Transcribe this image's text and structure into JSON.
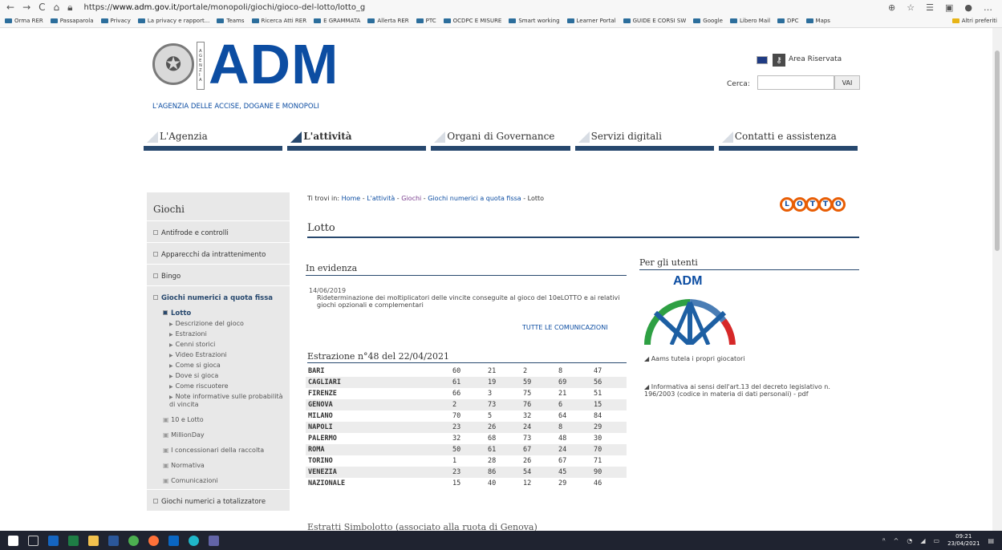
{
  "browser": {
    "url_prefix": "https://",
    "url_domain": "www.adm.gov.it",
    "url_path": "/portale/monopoli/giochi/gioco-del-lotto/lotto_g",
    "bookmarks": [
      "Orma RER",
      "Passaparola",
      "Privacy",
      "La privacy e rapport...",
      "Teams",
      "Ricerca Atti RER",
      "E GRAMMATA",
      "Allerta RER",
      "PTC",
      "OCDPC E MISURE",
      "Smart working",
      "Learner Portal",
      "GUIDE E CORSI SW",
      "Google",
      "Libero Mail",
      "DPC",
      "Maps"
    ],
    "other_bookmarks": "Altri preferiti"
  },
  "header": {
    "logo_text": "ADM",
    "agency_name": "L'AGENZIA DELLE ACCISE, DOGANE E MONOPOLI",
    "reserved_area": "Area Riservata",
    "search_label": "Cerca:",
    "search_button": "VAI"
  },
  "nav": {
    "items": [
      {
        "label": "L'Agenzia",
        "active": false
      },
      {
        "label": "L'attività",
        "active": true
      },
      {
        "label": "Organi di Governance",
        "active": false
      },
      {
        "label": "Servizi digitali",
        "active": false
      },
      {
        "label": "Contatti e assistenza",
        "active": false
      }
    ]
  },
  "sidebar": {
    "title": "Giochi",
    "items": [
      "Antifrode e controlli",
      "Apparecchi da intrattenimento",
      "Bingo"
    ],
    "open_item": "Giochi numerici a quota fissa",
    "open_sub": "Lotto",
    "leaves": [
      "Descrizione del gioco",
      "Estrazioni",
      "Cenni storici",
      "Video Estrazioni",
      "Come si gioca",
      "Dove si gioca",
      "Come riscuotere",
      "Note informative sulle probabilità di vincita"
    ],
    "others": [
      "10 e Lotto",
      "MillionDay",
      "I concessionari della raccolta",
      "Normativa",
      "Comunicazioni"
    ],
    "next_item": "Giochi numerici a totalizzatore"
  },
  "breadcrumb": {
    "prefix": "Ti trovi in:",
    "home": "Home",
    "sep": " - ",
    "attivita": "L'attività",
    "giochi": "Giochi",
    "quota": "Giochi numerici a quota fissa",
    "current": "Lotto"
  },
  "lotto_logo_letters": [
    "L",
    "O",
    "T",
    "T",
    "O"
  ],
  "page_title": "Lotto",
  "evidenza": {
    "title": "In evidenza",
    "date": "14/06/2019",
    "text": "Rideterminazione dei moltiplicatori delle vincite conseguite al gioco del 10eLOTTO e ai relativi giochi opzionali e complementari",
    "all_link": "TUTTE LE COMUNICAZIONI"
  },
  "estrazione": {
    "title": "Estrazione n°48 del 22/04/2021",
    "rows": [
      {
        "city": "BARI",
        "n": [
          "60",
          "21",
          "2",
          "8",
          "47"
        ]
      },
      {
        "city": "CAGLIARI",
        "n": [
          "61",
          "19",
          "59",
          "69",
          "56"
        ]
      },
      {
        "city": "FIRENZE",
        "n": [
          "66",
          "3",
          "75",
          "21",
          "51"
        ]
      },
      {
        "city": "GENOVA",
        "n": [
          "2",
          "73",
          "76",
          "6",
          "15"
        ]
      },
      {
        "city": "MILANO",
        "n": [
          "70",
          "5",
          "32",
          "64",
          "84"
        ]
      },
      {
        "city": "NAPOLI",
        "n": [
          "23",
          "26",
          "24",
          "8",
          "29"
        ]
      },
      {
        "city": "PALERMO",
        "n": [
          "32",
          "68",
          "73",
          "48",
          "30"
        ]
      },
      {
        "city": "ROMA",
        "n": [
          "50",
          "61",
          "67",
          "24",
          "70"
        ]
      },
      {
        "city": "TORINO",
        "n": [
          "1",
          "28",
          "26",
          "67",
          "71"
        ]
      },
      {
        "city": "VENEZIA",
        "n": [
          "23",
          "86",
          "54",
          "45",
          "90"
        ]
      },
      {
        "city": "NAZIONALE",
        "n": [
          "15",
          "40",
          "12",
          "29",
          "46"
        ]
      }
    ]
  },
  "simbolotto_title": "Estratti Simbolotto (associato alla ruota di Genova)",
  "per_utenti": {
    "title": "Per gli utenti",
    "logo_text": "ADM",
    "link1": "Aams tutela i propri giocatori",
    "link2": "Informativa ai sensi dell'art.13 del decreto legislativo n. 196/2003 (codice in materia di dati personali) - pdf"
  },
  "taskbar": {
    "time": "09:21",
    "date": "23/04/2021"
  },
  "colors": {
    "brand_blue": "#0c4da2",
    "nav_dark": "#27486e",
    "lotto_orange": "#e85d04"
  }
}
